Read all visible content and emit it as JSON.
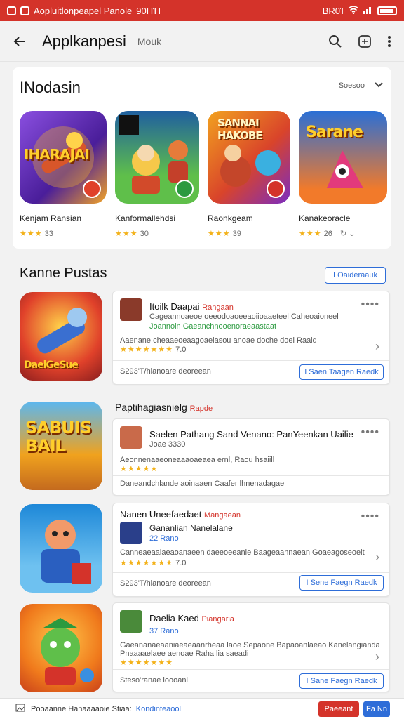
{
  "status_bar": {
    "left_text": "Aopluitlonpeapel Panole",
    "left_time": "90ΠΉ",
    "right_text": "BR0Ί"
  },
  "header": {
    "title": "Applkanpesi",
    "subtitle": "Mouk"
  },
  "featured": {
    "title": "INodasin",
    "more_label": "Soesoo",
    "items": [
      {
        "name": "Kenjam Ransian",
        "stars": "★★★",
        "rating": "33",
        "art_text": "IHARAJAI",
        "bg": "#6a3dbf"
      },
      {
        "name": "Kanformallehdsi",
        "stars": "★★★",
        "rating": "30",
        "art_text": "",
        "bg": "#3c9a3a"
      },
      {
        "name": "Raonkgeam",
        "stars": "★★★",
        "rating": "39",
        "art_text": "SANNAI HAKOBE",
        "bg": "#d94b27"
      },
      {
        "name": "Kanakeoracle",
        "stars": "★★★",
        "rating": "26",
        "art_text": "Sarane",
        "bg": "#2a6fd6"
      }
    ]
  },
  "section2": {
    "title": "Kanne Pustas",
    "button": "I Oaideraauk"
  },
  "between_label": {
    "text": "Paptihagiasnielg",
    "tag": "Rapde"
  },
  "cards": [
    {
      "title": "Itoilk Daapai",
      "tag": "Rangaan",
      "line1": "Cageannoaeoe oeeodoaoeeaoiioaaeteel Caheoaioneel",
      "line2": "Joannoin Gaeanchnooenoraeaastaat",
      "line3": "Aaenane cheaaeoeaagoaelasou anoae doche doel Raaid",
      "stars": "★★★★★★★",
      "rating": "7.0",
      "footer": "S293'T/hianoare deoreean",
      "button": "I Saen Taagen Raedk",
      "art_text": "DaelGeSue",
      "art_bg": "#e0412a"
    },
    {
      "title": "Saelen Pathang Sand Venano: PanYeenkan Uailie",
      "tag": "",
      "line1": "Joae 3330",
      "line2": "",
      "line3": "Aeonnenaaeoneaaaoaeaea ernl, Raou hsaiill",
      "stars": "★★★★★",
      "rating": "",
      "footer": "Daneandchlande aoinaaen Caafer lhnenadagae",
      "button": "",
      "art_text": "SABUIS BAIL",
      "art_bg": "#f0a21e"
    },
    {
      "title": "Nanen Uneefaedaet",
      "tag": "Mangaean",
      "line1": "Gananlian Nanelalane",
      "line2": "22 Rano",
      "line3": "Canneaeaaiaeaoanaeen daeeoeeanie Baageaannaean Goaeagoseoeit",
      "stars": "★★★★★★★",
      "rating": "7.0",
      "footer": "S293'T/hianoare deoreean",
      "button": "I Sene Faegn Raedk",
      "art_text": "",
      "art_bg": "#1e88d8"
    },
    {
      "title": "Daelia Kaed",
      "tag": "Piangaria",
      "line1": "37 Rano",
      "line2": "",
      "line3": "Gaeananaeaaniaeaeaanrheaa laoe Sepaone Bapaoanlaeao Kanelangianda",
      "line4": "Pnaaaaelaee aenoae Raha lia saeadi",
      "stars": "★★★★★★★",
      "rating": "",
      "footer": "Steso'ranae loooanl",
      "button": "I Sane Faegn Raedk",
      "art_text": "",
      "art_bg": "#f07a1c"
    }
  ],
  "bottom_bar": {
    "text": "Pooaanne Hanaaaaoie Stiaa:",
    "link": "Kondinteaool",
    "red_button": "Paeeant",
    "blue_button": "Fa Nn"
  },
  "colors": {
    "accent_red": "#d4332a",
    "accent_blue": "#2e6dd8",
    "star": "#f3b21b"
  }
}
